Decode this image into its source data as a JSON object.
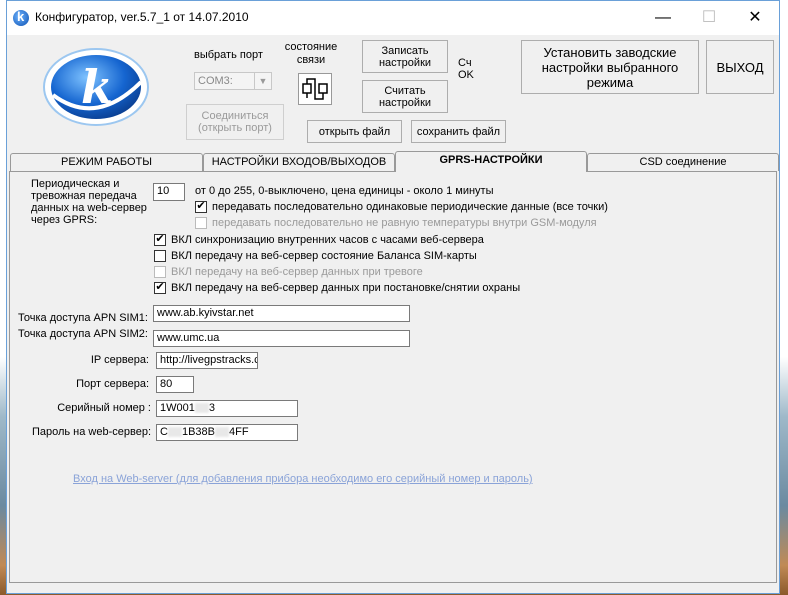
{
  "window": {
    "title": "Конфигуратор, ver.5.7_1 от 14.07.2010"
  },
  "top": {
    "port_label": "выбрать порт",
    "port_value": "COM3:",
    "conn_state_label": "состояние связи",
    "connect_button": "Соединиться (открыть порт)",
    "write_button": "Записать настройки",
    "read_button": "Считать настройки",
    "status_line1": "Сч",
    "status_line2": "OK",
    "factory_button": "Установить заводские настройки выбранного режима",
    "exit_button": "ВЫХОД",
    "open_file_button": "открыть файл",
    "save_file_button": "сохранить файл"
  },
  "tabs": [
    "РЕЖИМ РАБОТЫ",
    "НАСТРОЙКИ ВХОДОВ/ВЫХОДОВ",
    "GPRS-НАСТРОЙКИ",
    "CSD соединение"
  ],
  "gprs": {
    "period_label": "Периодическая и тревожная передача данных на web-сервер через GPRS:",
    "period_value": "10",
    "period_hint": "от 0 до 255, 0-выключено, цена единицы - около 1 минуты",
    "checkboxes": [
      {
        "label": "передавать последовательно одинаковые периодические данные (все точки)",
        "checked": true,
        "disabled": false
      },
      {
        "label": "передавать последовательно не равную температуры внутри GSM-модуля",
        "checked": false,
        "disabled": true
      },
      {
        "label": "ВКЛ синхронизацию внутренних часов с часами веб-сервера",
        "checked": true,
        "disabled": false
      },
      {
        "label": "ВКЛ передачу на веб-сервер состояние Баланса SIM-карты",
        "checked": false,
        "disabled": false
      },
      {
        "label": "ВКЛ передачу на веб-сервер данных при тревоге",
        "checked": false,
        "disabled": true
      },
      {
        "label": "ВКЛ передачу на веб-сервер данных при постановке/снятии охраны",
        "checked": true,
        "disabled": false
      }
    ],
    "apn1_label": "Точка доступа APN  SIM1:",
    "apn1_value": "www.ab.kyivstar.net",
    "apn2_label": "Точка доступа APN SIM2:",
    "apn2_value": "www.umc.ua",
    "ip_label": "IP сервера:",
    "ip_value": "http://livegpstracks.c",
    "port_label": "Порт сервера:",
    "port_value": "80",
    "serial_label": "Серийный номер :",
    "serial_prefix": "1W001",
    "serial_suffix": "3",
    "password_label": "Пароль на web-сервер:",
    "password_prefix": "C",
    "password_mid": "1B38B",
    "password_suffix": "4FF",
    "link": "Вход на Web-server (для добавления прибора необходимо его серийный номер и пароль)"
  },
  "colors": {
    "window_bg": "#f0f0f0",
    "link": "#8aa3d8",
    "logo_blue": "#0a5bc4"
  }
}
